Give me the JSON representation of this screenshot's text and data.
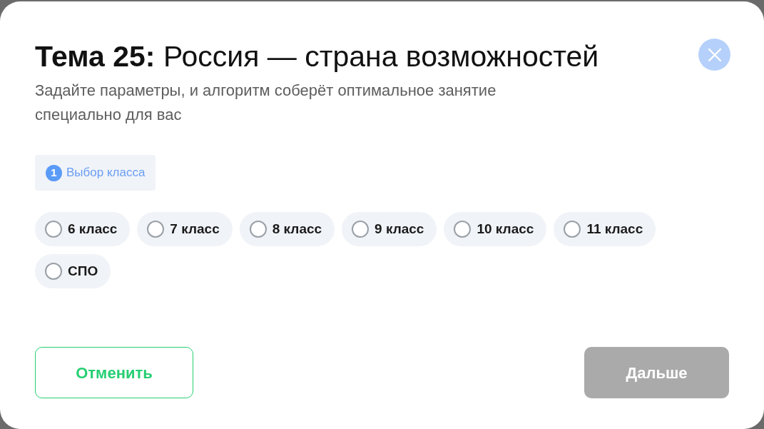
{
  "dialog": {
    "title": "**Тема 25:** Россия — страна возможностей",
    "subtitle": "Задайте параметры, и алгоритм соберёт оптимальное занятие специально для вас"
  },
  "step": {
    "number": "1",
    "label": "Выбор класса"
  },
  "options": [
    {
      "label": "6 класс",
      "selected": false
    },
    {
      "label": "7 класс",
      "selected": false
    },
    {
      "label": "8 класс",
      "selected": false
    },
    {
      "label": "9 класс",
      "selected": false
    },
    {
      "label": "10 класс",
      "selected": false
    },
    {
      "label": "11 класс",
      "selected": false
    },
    {
      "label": "СПО",
      "selected": false
    }
  ],
  "buttons": {
    "cancel": {
      "label": "Отменить"
    },
    "next": {
      "label": "Дальше",
      "disabled": true
    }
  }
}
